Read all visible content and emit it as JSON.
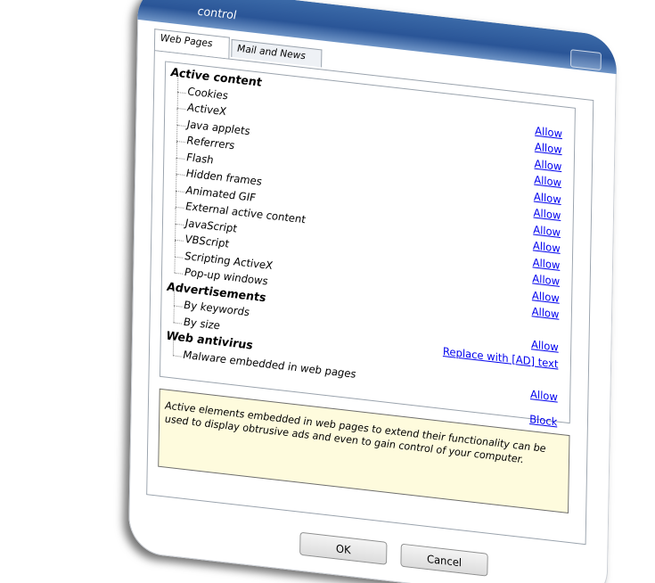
{
  "window": {
    "title": "control"
  },
  "tabs": [
    {
      "label": "Web Pages",
      "active": true
    },
    {
      "label": "Mail and News",
      "active": false
    }
  ],
  "groups": [
    {
      "label": "Active content",
      "items": [
        {
          "label": "Cookies",
          "action": "Allow"
        },
        {
          "label": "ActiveX",
          "action": "Allow"
        },
        {
          "label": "Java applets",
          "action": "Allow"
        },
        {
          "label": "Referrers",
          "action": "Allow"
        },
        {
          "label": "Flash",
          "action": "Allow"
        },
        {
          "label": "Hidden frames",
          "action": "Allow"
        },
        {
          "label": "Animated GIF",
          "action": "Allow"
        },
        {
          "label": "External active content",
          "action": "Allow"
        },
        {
          "label": "JavaScript",
          "action": "Allow"
        },
        {
          "label": "VBScript",
          "action": "Allow"
        },
        {
          "label": "Scripting ActiveX",
          "action": "Allow"
        },
        {
          "label": "Pop-up windows",
          "action": "Allow"
        }
      ]
    },
    {
      "label": "Advertisements",
      "items": [
        {
          "label": "By keywords",
          "action": "Allow"
        },
        {
          "label": "By size",
          "action": "Replace with [AD] text"
        }
      ]
    },
    {
      "label": "Web antivirus",
      "items": [
        {
          "label": "Malware embedded in web pages",
          "action": "Allow"
        }
      ]
    }
  ],
  "extra_action": "Block",
  "description": "Active elements embedded in web pages to extend their functionality can be used to display obtrusive ads and even to gain control of your computer.",
  "buttons": {
    "ok": "OK",
    "cancel": "Cancel"
  },
  "colors": {
    "link": "#0000ee",
    "description_bg": "#fefbdd",
    "titlebar": "#2a5597"
  },
  "icons": {
    "help": "help-icon"
  }
}
